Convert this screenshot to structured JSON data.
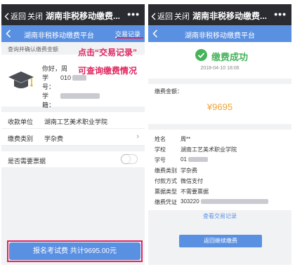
{
  "wechat": {
    "back_label": "返回",
    "close_label": "关闭",
    "title": "湖南非税移动缴费...",
    "more": "•••"
  },
  "colors": {
    "nav_bar": "#2b2c31",
    "header_blue": "#5a90e2",
    "annotation_red": "#e0245e",
    "success_green": "#45b35a",
    "amount_orange": "#f0a436"
  },
  "left": {
    "header_title": "湖南非税移动缴费平台",
    "records_link": "交易记录",
    "section_caption": "查询并确认缴费金额",
    "student": {
      "greeting_label": "你好，",
      "greeting_value": "周",
      "id_label": "学号：",
      "id_value": "010",
      "college_label": "学籍："
    },
    "annotation_line1": "点击“交易记录”",
    "annotation_line2": "可查询缴费情况",
    "payee_label": "收款单位",
    "payee_value": "湖南工艺美术职业学院",
    "category_label": "缴费类别",
    "category_value": "学杂费",
    "receipt_label": "是否需要票据",
    "receipt_toggle": false,
    "submit_button": "报名考试费 共计9695.00元"
  },
  "right": {
    "header_title": "湖南非税移动缴费平台",
    "success_text": "缴费成功",
    "success_time": "2018-04-10 18:06",
    "amount_label": "缴费金额：",
    "amount_value": "¥9695",
    "details": [
      {
        "k": "姓名",
        "v": "周**"
      },
      {
        "k": "学校",
        "v": "湖南工艺美术职业学院"
      },
      {
        "k": "学号",
        "v": "01"
      },
      {
        "k": "缴费类别",
        "v": "学杂费"
      },
      {
        "k": "付款方式",
        "v": "微信支付"
      },
      {
        "k": "票据类型",
        "v": "不需要票据"
      },
      {
        "k": "缴费凭证",
        "v": "303220"
      }
    ],
    "view_records_link": "查看交易记录",
    "return_button": "返回继续缴费"
  }
}
